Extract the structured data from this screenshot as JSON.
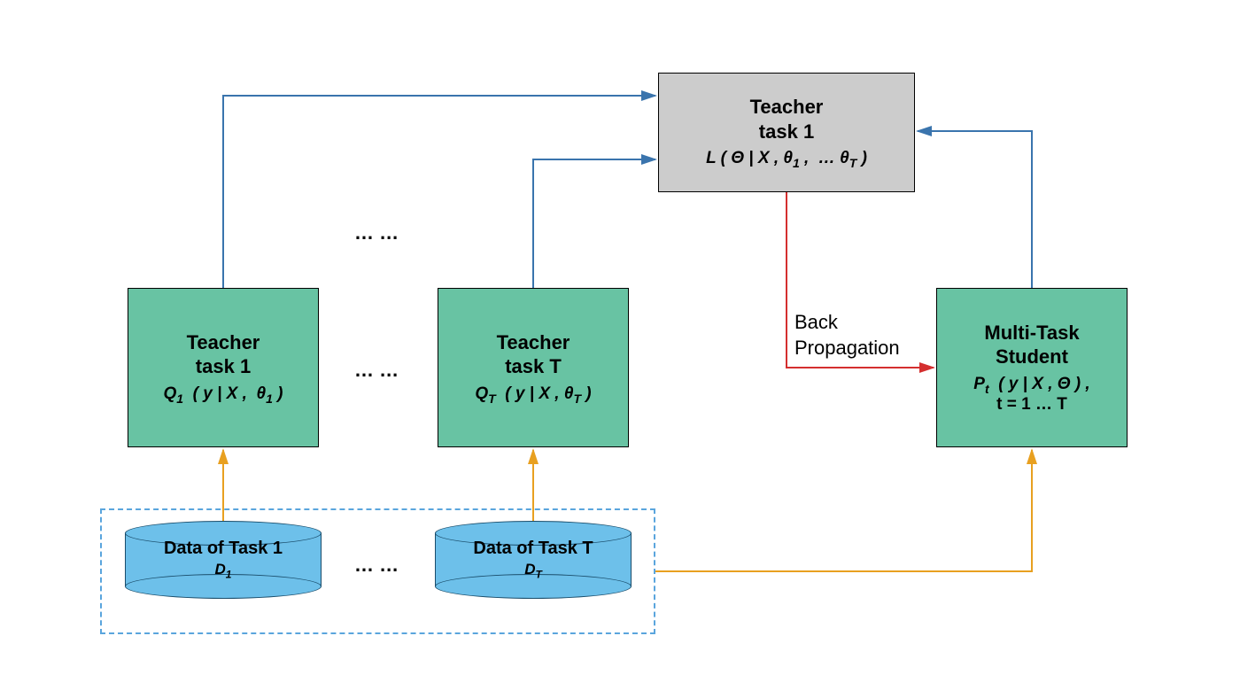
{
  "nodes": {
    "loss": {
      "title": "Teacher\ntask 1",
      "formula": "L ( Θ | X , θ₁ , … θ_T )"
    },
    "teacher1": {
      "title": "Teacher\ntask 1",
      "formula": "Q₁ ( y | X , θ₁ )"
    },
    "teacherT": {
      "title": "Teacher\ntask T",
      "formula": "Q_T ( y | X , θ_T )"
    },
    "student": {
      "title": "Multi-Task\nStudent",
      "formula": "P_t ( y | X , Θ ) ,\nt = 1 … T"
    },
    "data1": {
      "title": "Data of Task 1",
      "sub": "D₁"
    },
    "dataT": {
      "title": "Data of Task T",
      "sub": "D_T"
    }
  },
  "labels": {
    "backprop": "Back\nPropagation",
    "ellipsis": "… …"
  },
  "colors": {
    "teal": "#68c3a3",
    "gray": "#cccccc",
    "cylinder": "#6dc0ea",
    "arrow_blue": "#3a74ad",
    "arrow_yellow": "#e8a020",
    "arrow_red": "#d42f2f",
    "dash": "#5aa5dd"
  }
}
